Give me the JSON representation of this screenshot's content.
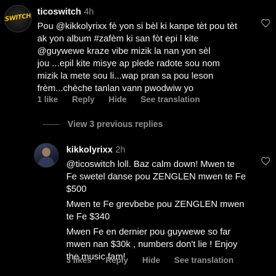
{
  "comment": {
    "avatar_text": "SWITCH",
    "username": "ticoswitch",
    "time": "4h",
    "lines": [
      "Pou @kikkolyrixx fè yon si bèl ki kanpe tèt pou tèt",
      "ak yon album #zafèm ki san fòt epi l kite",
      "@guywewe kraze vibe mizik la nan yon sèl",
      "jou ...epil kite misye ap plede radote sou nom",
      "mizik la mete sou li...wap pran sa pou leson",
      "frèm...chèche tanlan vann pwodwiw yo"
    ],
    "actions": {
      "likes": "1 like",
      "reply": "Reply",
      "hide": "Hide",
      "translation": "See translation"
    }
  },
  "view_previous": "View 3 previous replies",
  "reply": {
    "username": "kikkolyrixx",
    "time": "2h",
    "lines": [
      "@ticoswitch loll. Baz calm down! Mwen te",
      "Fe swetel danse pou ZENGLEN mwen te Fe",
      "$500",
      "Mwen te Fe grevbebe pou ZENGLEN mwen",
      "te Fe $340",
      "Mwen Fe en dernier pou guywewe so far",
      "mwen nan $30k , numbers don't lie ! Enjoy",
      "the music fam!"
    ],
    "actions": {
      "likes": "3 likes",
      "reply": "Reply",
      "hide": "Hide",
      "translation": "See translation"
    }
  },
  "colors": {
    "background": "#000000",
    "text": "#f5f5f5",
    "muted": "#8e8e8e",
    "logo": "#f2c200"
  }
}
